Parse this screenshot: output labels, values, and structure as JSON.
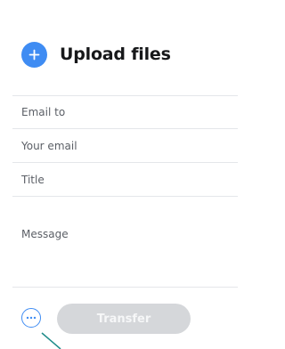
{
  "upload": {
    "label": "Upload files",
    "icon": "plus-icon",
    "accent_color": "#3f8cf3"
  },
  "form": {
    "email_to": {
      "placeholder": "Email to",
      "value": ""
    },
    "your_email": {
      "placeholder": "Your email",
      "value": ""
    },
    "title": {
      "placeholder": "Title",
      "value": ""
    },
    "message": {
      "placeholder": "Message",
      "value": ""
    }
  },
  "footer": {
    "more_icon": "more-options-icon",
    "transfer_label": "Transfer",
    "transfer_disabled": true
  }
}
